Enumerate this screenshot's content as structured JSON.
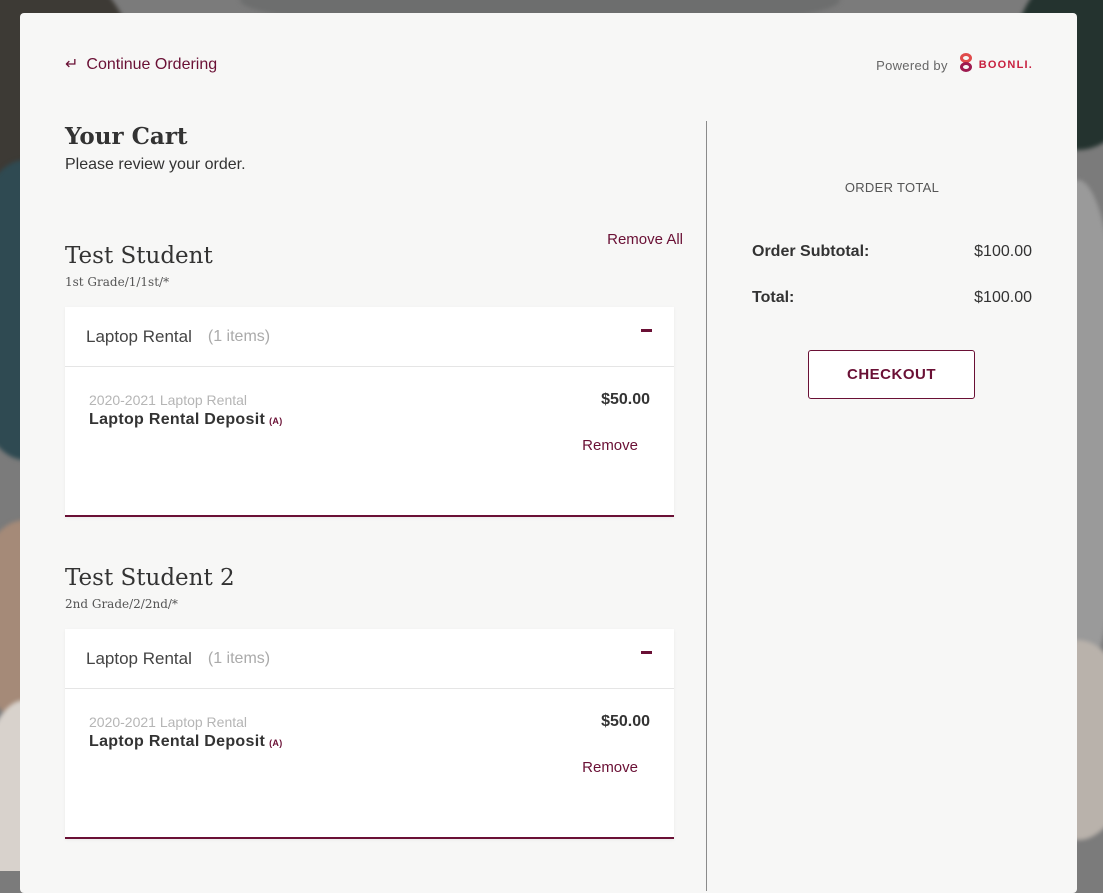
{
  "header": {
    "continue_label": "Continue Ordering",
    "powered_by": "Powered by",
    "brand": "BOONLI."
  },
  "cart": {
    "title": "Your Cart",
    "subtitle": "Please review your order.",
    "remove_all": "Remove All"
  },
  "students": [
    {
      "name": "Test Student",
      "grade": "1st Grade/1/1st/*",
      "group": {
        "title": "Laptop Rental",
        "count": "(1 items)",
        "item": {
          "year": "2020-2021 Laptop Rental",
          "name": "Laptop Rental Deposit",
          "tag": "(A)",
          "price": "$50.00",
          "remove": "Remove"
        }
      }
    },
    {
      "name": "Test Student 2",
      "grade": "2nd Grade/2/2nd/*",
      "group": {
        "title": "Laptop Rental",
        "count": "(1 items)",
        "item": {
          "year": "2020-2021 Laptop Rental",
          "name": "Laptop Rental Deposit",
          "tag": "(A)",
          "price": "$50.00",
          "remove": "Remove"
        }
      }
    }
  ],
  "summary": {
    "title": "ORDER TOTAL",
    "subtotal_label": "Order Subtotal:",
    "subtotal_value": "$100.00",
    "total_label": "Total:",
    "total_value": "$100.00",
    "checkout_label": "CHECKOUT"
  },
  "colors": {
    "accent": "#6a1035",
    "brand": "#c8203f"
  }
}
